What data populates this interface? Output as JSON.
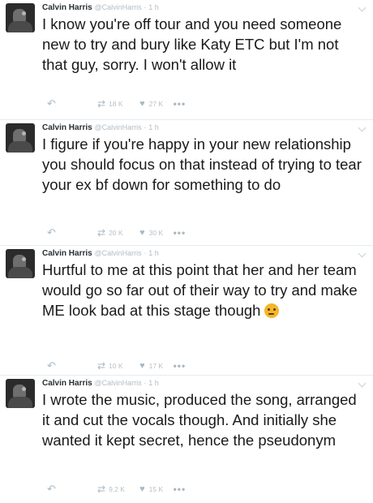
{
  "tweets": [
    {
      "name": "Calvin Harris",
      "handle": "@CalvinHarris",
      "time": "1 h",
      "text": "I know you're off tour and you need someone new to try and bury like Katy ETC but I'm not that guy, sorry. I won't allow it",
      "retweets": "18 K",
      "likes": "27 K"
    },
    {
      "name": "Calvin Harris",
      "handle": "@CalvinHarris",
      "time": "1 h",
      "text": "I figure if you're happy in your new relationship you should focus on that instead of trying to tear your ex bf down for something to do",
      "retweets": "20 K",
      "likes": "30 K"
    },
    {
      "name": "Calvin Harris",
      "handle": "@CalvinHarris",
      "time": "1 h",
      "text": "Hurtful to me at this point that her and her team would go so far out of their way to try and make ME look bad at this stage though",
      "emoji": "thinking-face-emoji",
      "retweets": "10 K",
      "likes": "17 K"
    },
    {
      "name": "Calvin Harris",
      "handle": "@CalvinHarris",
      "time": "1 h",
      "text": "I wrote the music, produced the song, arranged it and cut the vocals though. And initially she wanted it kept secret, hence the pseudonym",
      "retweets": "9.2 K",
      "likes": "15 K"
    }
  ],
  "icons": {
    "reply": "reply-icon",
    "retweet": "retweet-icon",
    "like": "heart-icon",
    "more": "more-icon",
    "menu": "chevron-down-icon"
  },
  "colors": {
    "text": "#1a1a1a",
    "meta": "#b2bcc4",
    "divider": "#e6ecf0"
  }
}
